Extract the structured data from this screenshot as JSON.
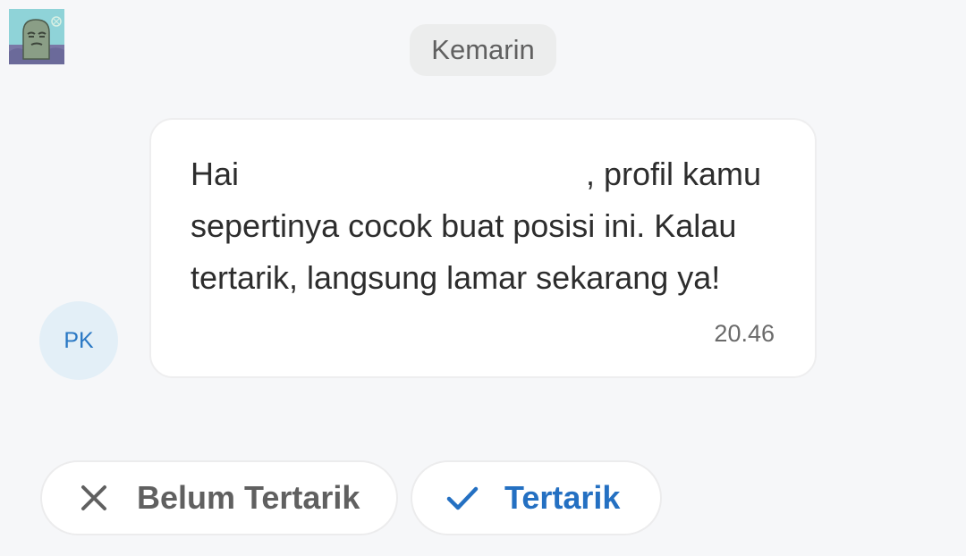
{
  "header": {
    "date_label": "Kemarin"
  },
  "message": {
    "sender_initials": "PK",
    "greeting": "Hai",
    "line1_end": ", profil kamu",
    "line2": "sepertinya cocok buat posisi ini. Kalau",
    "line3": "tertarik, langsung lamar sekarang ya!",
    "time": "20.46"
  },
  "actions": {
    "decline_label": "Belum Tertarik",
    "decline_icon": "close-icon",
    "accept_label": "Tertarik",
    "accept_icon": "check-icon"
  },
  "colors": {
    "accent": "#2470c2",
    "background": "#f6f7f9"
  }
}
